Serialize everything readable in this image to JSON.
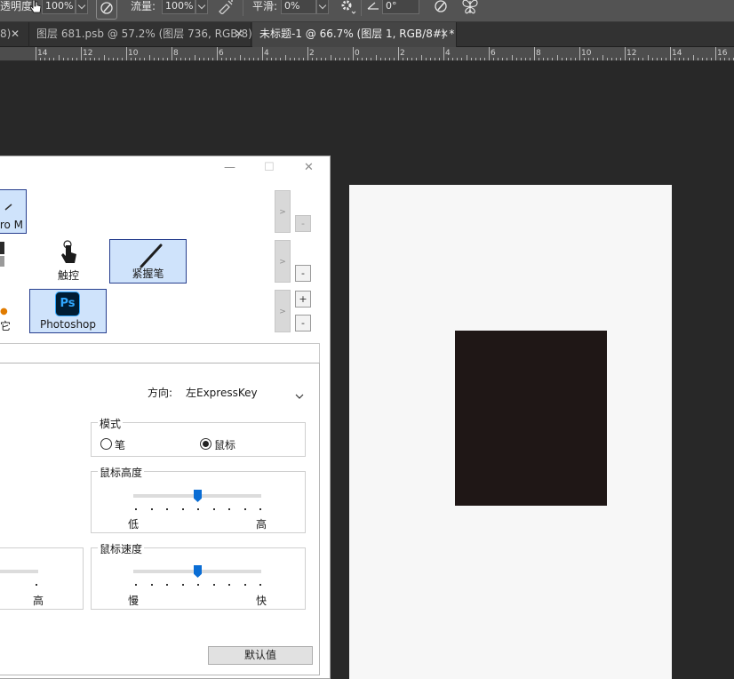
{
  "options_bar": {
    "opacity_label": "透明度",
    "opacity_value": "100%",
    "flow_label": "流量:",
    "flow_value": "100%",
    "smoothing_label": "平滑:",
    "smoothing_value": "0%",
    "angle_value": "0°"
  },
  "tabs": [
    {
      "label": "8)",
      "active": false
    },
    {
      "label": "图层 681.psb @ 57.2% (图层 736, RGB/8)",
      "active": false
    },
    {
      "label": "未标题-1 @ 66.7% (图层 1, RGB/8#) *",
      "active": true
    }
  ],
  "ruler": {
    "labels": [
      "14",
      "12",
      "10",
      "8",
      "6",
      "4",
      "2",
      "0",
      "2",
      "4",
      "6",
      "8",
      "10",
      "12",
      "14",
      "16"
    ]
  },
  "dialog": {
    "title_buttons": {
      "minimize": "—",
      "maximize": "☐",
      "close": "✕"
    },
    "tiles": {
      "pro_label": "ro M",
      "touch_label": "触控",
      "grip_pen_label": "紧握笔",
      "other_label": "它",
      "photoshop_label": "Photoshop",
      "photoshop_icon_text": "Ps"
    },
    "scroll_arrow": ">",
    "plus_label": "+",
    "minus_label": "-",
    "orientation_label": "方向:",
    "orientation_value": "左ExpressKey",
    "mode": {
      "title": "模式",
      "pen_label": "笔",
      "mouse_label": "鼠标",
      "selected": "mouse"
    },
    "mouse_height": {
      "title": "鼠标高度",
      "low_label": "低",
      "high_label": "高",
      "level": 0.5
    },
    "mouse_speed": {
      "title": "鼠标速度",
      "slow_label": "慢",
      "fast_label": "快",
      "level": 0.5
    },
    "left_slider": {
      "high_label": "高"
    },
    "default_button": "默认值"
  },
  "colors": {
    "workspace": "#282828",
    "document": "#f7f7f7",
    "layer_fill": "#1f1716",
    "tile_selected": "#cfe3fb",
    "slider_thumb": "#0a6dd4"
  }
}
